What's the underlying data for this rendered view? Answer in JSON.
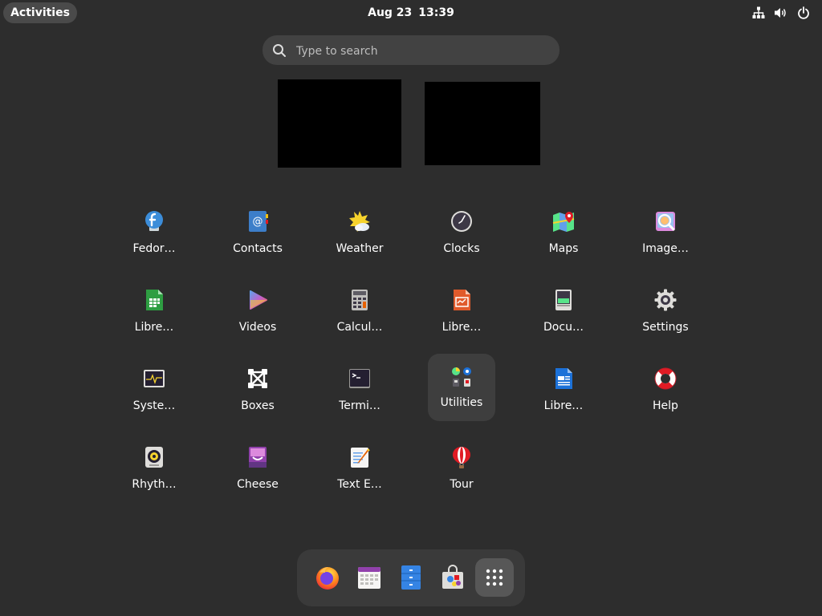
{
  "topbar": {
    "activities": "Activities",
    "date": "Aug 23",
    "time": "13:39",
    "status_icons": [
      "network-icon",
      "volume-icon",
      "power-icon"
    ]
  },
  "search": {
    "placeholder": "Type to search",
    "value": ""
  },
  "apps": [
    {
      "label": "Fedor…",
      "icon": "fedora-media-writer-icon"
    },
    {
      "label": "Contacts",
      "icon": "contacts-icon"
    },
    {
      "label": "Weather",
      "icon": "weather-icon"
    },
    {
      "label": "Clocks",
      "icon": "clocks-icon"
    },
    {
      "label": "Maps",
      "icon": "maps-icon"
    },
    {
      "label": "Image…",
      "icon": "image-viewer-icon"
    },
    {
      "label": "Libre…",
      "icon": "libreoffice-calc-icon"
    },
    {
      "label": "Videos",
      "icon": "videos-icon"
    },
    {
      "label": "Calcul…",
      "icon": "calculator-icon"
    },
    {
      "label": "Libre…",
      "icon": "libreoffice-impress-icon"
    },
    {
      "label": "Docu…",
      "icon": "document-scanner-icon"
    },
    {
      "label": "Settings",
      "icon": "settings-gear-icon"
    },
    {
      "label": "Syste…",
      "icon": "system-monitor-icon"
    },
    {
      "label": "Boxes",
      "icon": "boxes-icon"
    },
    {
      "label": "Termi…",
      "icon": "terminal-icon"
    },
    {
      "label": "Utilities",
      "icon": "utilities-folder-icon"
    },
    {
      "label": "Libre…",
      "icon": "libreoffice-writer-icon"
    },
    {
      "label": "Help",
      "icon": "help-lifebuoy-icon"
    },
    {
      "label": "Rhyth…",
      "icon": "rhythmbox-icon"
    },
    {
      "label": "Cheese",
      "icon": "cheese-icon"
    },
    {
      "label": "Text E…",
      "icon": "text-editor-icon"
    },
    {
      "label": "Tour",
      "icon": "tour-balloon-icon"
    }
  ],
  "dock": [
    "firefox-icon",
    "calendar-icon",
    "files-icon",
    "software-icon",
    "show-apps-grid-icon"
  ],
  "colors": {
    "background": "#2d2d2d",
    "panel": "#3a3a3a",
    "highlight": "#3e3e3e"
  }
}
